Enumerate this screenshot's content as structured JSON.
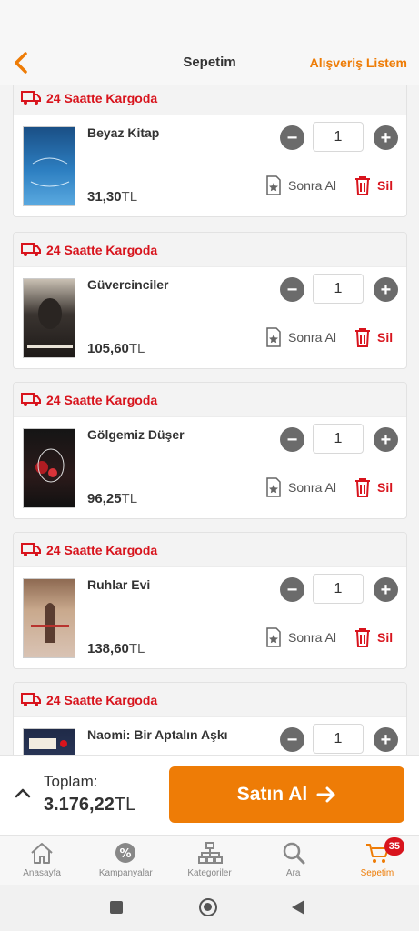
{
  "header": {
    "title": "Sepetim",
    "shopping_list": "Alışveriş Listem"
  },
  "shipping_label": "24 Saatte Kargoda",
  "actions": {
    "later": "Sonra Al",
    "delete": "Sil"
  },
  "items": [
    {
      "name": "Beyaz Kitap",
      "price": "31,30",
      "currency": "TL",
      "quantity": "1"
    },
    {
      "name": "Güvercinciler",
      "price": "105,60",
      "currency": "TL",
      "quantity": "1"
    },
    {
      "name": "Gölgemiz Düşer",
      "price": "96,25",
      "currency": "TL",
      "quantity": "1"
    },
    {
      "name": "Ruhlar Evi",
      "price": "138,60",
      "currency": "TL",
      "quantity": "1"
    },
    {
      "name": "Naomi: Bir Aptalın Aşkı",
      "price": "",
      "currency": "",
      "quantity": "1"
    }
  ],
  "summary": {
    "total_label": "Toplam:",
    "total_value": "3.176,22",
    "currency": "TL",
    "buy_label": "Satın Al"
  },
  "tabs": [
    {
      "label": "Anasayfa",
      "icon": "home-icon"
    },
    {
      "label": "Kampanyalar",
      "icon": "discount-icon"
    },
    {
      "label": "Kategoriler",
      "icon": "categories-icon"
    },
    {
      "label": "Ara",
      "icon": "search-icon"
    },
    {
      "label": "Sepetim",
      "icon": "cart-icon",
      "badge": "35",
      "active": true
    }
  ],
  "colors": {
    "accent": "#ee7c06",
    "danger": "#d8141d"
  }
}
